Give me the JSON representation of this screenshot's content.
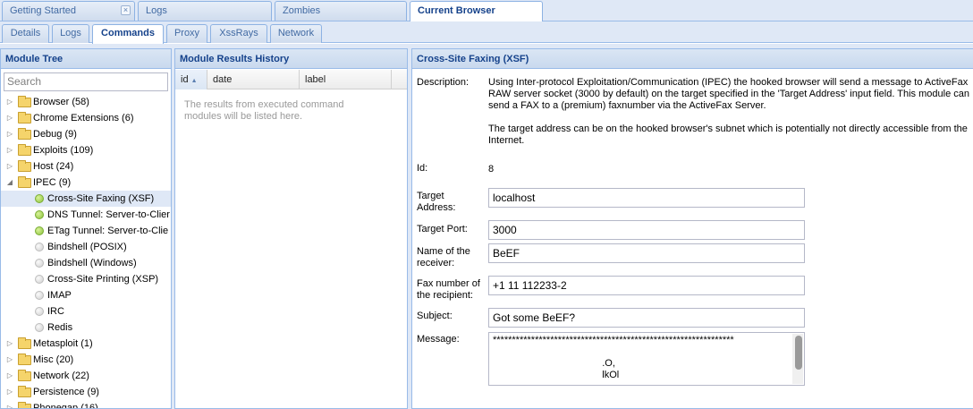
{
  "top_tabs": [
    {
      "label": "Getting Started",
      "closable": true
    },
    {
      "label": "Logs"
    },
    {
      "label": "Zombies"
    },
    {
      "label": "Current Browser",
      "active": true
    }
  ],
  "sub_tabs": [
    "Details",
    "Logs",
    "Commands",
    "Proxy",
    "XssRays",
    "Network"
  ],
  "active_sub_tab": "Commands",
  "module_tree": {
    "title": "Module Tree",
    "search_placeholder": "Search",
    "items": [
      {
        "label": "Browser (58)",
        "kind": "folder"
      },
      {
        "label": "Chrome Extensions (6)",
        "kind": "folder"
      },
      {
        "label": "Debug (9)",
        "kind": "folder"
      },
      {
        "label": "Exploits (109)",
        "kind": "folder"
      },
      {
        "label": "Host (24)",
        "kind": "folder"
      },
      {
        "label": "IPEC (9)",
        "kind": "folder",
        "expanded": true
      },
      {
        "label": "Cross-Site Faxing (XSF)",
        "kind": "module",
        "status": "green",
        "selected": true
      },
      {
        "label": "DNS Tunnel: Server-to-Clier",
        "kind": "module",
        "status": "green"
      },
      {
        "label": "ETag Tunnel: Server-to-Clie",
        "kind": "module",
        "status": "green"
      },
      {
        "label": "Bindshell (POSIX)",
        "kind": "module",
        "status": "grey"
      },
      {
        "label": "Bindshell (Windows)",
        "kind": "module",
        "status": "grey"
      },
      {
        "label": "Cross-Site Printing (XSP)",
        "kind": "module",
        "status": "grey"
      },
      {
        "label": "IMAP",
        "kind": "module",
        "status": "grey"
      },
      {
        "label": "IRC",
        "kind": "module",
        "status": "grey"
      },
      {
        "label": "Redis",
        "kind": "module",
        "status": "grey"
      },
      {
        "label": "Metasploit (1)",
        "kind": "folder"
      },
      {
        "label": "Misc (20)",
        "kind": "folder"
      },
      {
        "label": "Network (22)",
        "kind": "folder"
      },
      {
        "label": "Persistence (9)",
        "kind": "folder"
      },
      {
        "label": "Phonegap (16)",
        "kind": "folder"
      }
    ]
  },
  "results": {
    "title": "Module Results History",
    "columns": [
      "id",
      "date",
      "label"
    ],
    "sort_indicator": "▲",
    "empty_text": "The results from executed command modules will be listed here."
  },
  "module": {
    "title": "Cross-Site Faxing (XSF)",
    "description_label": "Description:",
    "description_1": "Using Inter-protocol Exploitation/Communication (IPEC) the hooked browser will send a message to ActiveFax RAW server socket (3000 by default) on the target specified in the 'Target Address' input field. This module can send a FAX to a (premium) faxnumber via the ActiveFax Server.",
    "description_2": "The target address can be on the hooked browser's subnet which is potentially not directly accessible from the Internet.",
    "id_label": "Id:",
    "id_value": "8",
    "target_address_label": "Target Address:",
    "target_address": "localhost",
    "target_port_label": "Target Port:",
    "target_port": "3000",
    "receiver_label": "Name of the receiver:",
    "receiver": "BeEF",
    "fax_label": "Fax number of the recipient:",
    "fax": "+1 11 112233-2",
    "subject_label": "Subject:",
    "subject": "Got some BeEF?",
    "message_label": "Message:",
    "message": "***************************************************************\n\n                                        .O,\n                                        lkOl"
  }
}
